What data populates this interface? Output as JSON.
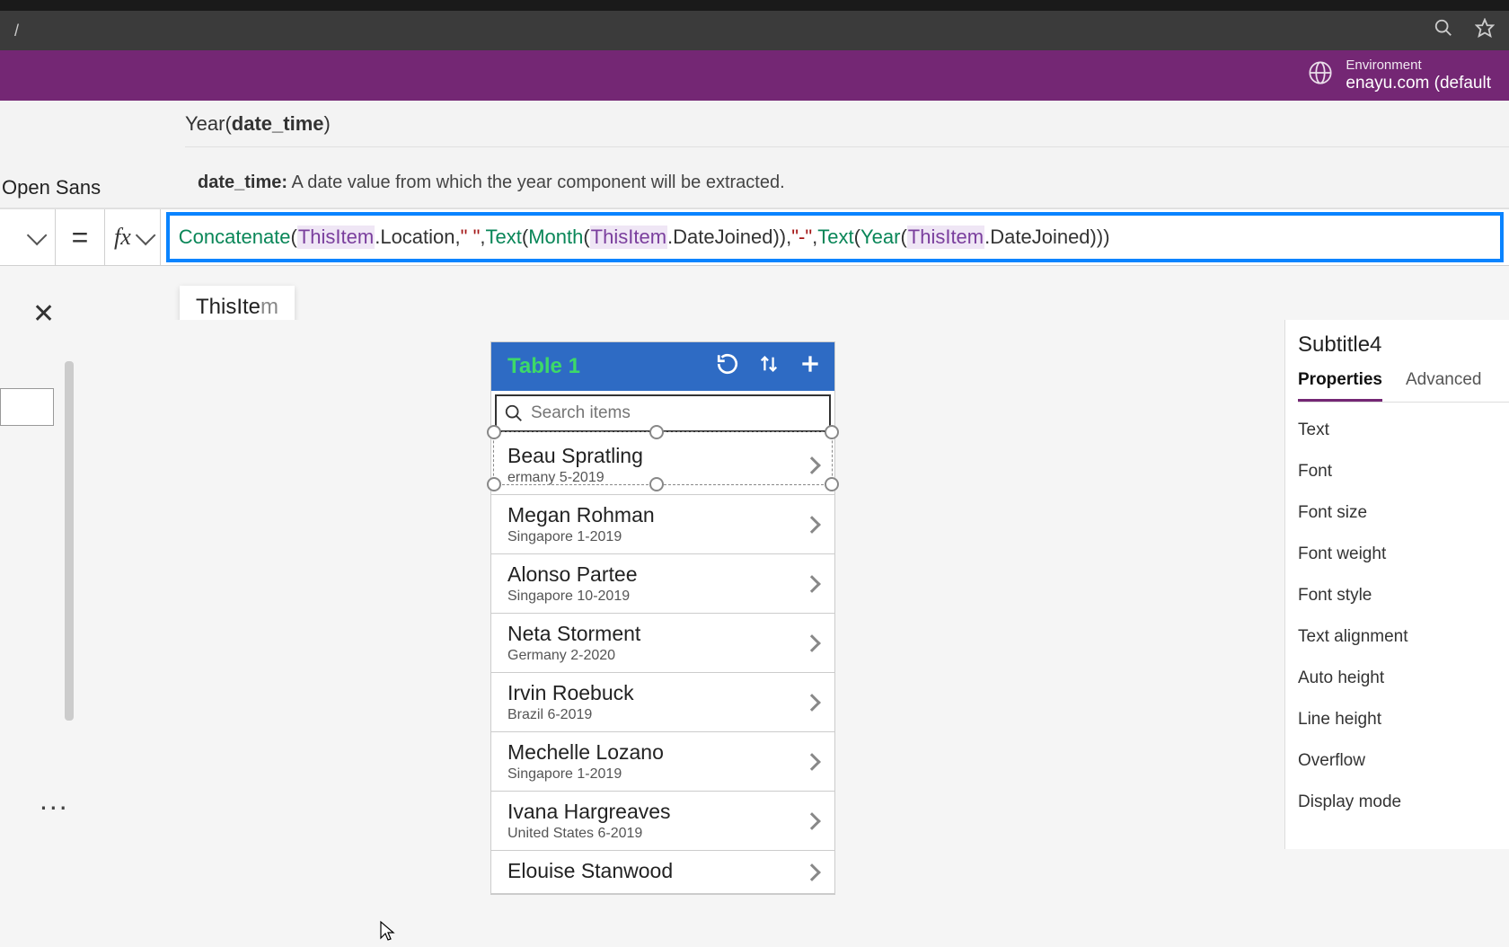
{
  "browser": {
    "url": "/",
    "search_icon": "search",
    "star_icon": "star"
  },
  "header": {
    "env_label": "Environment",
    "env_value": "enayu.com (default"
  },
  "ribbon": {
    "font_name": "Open Sans"
  },
  "help": {
    "signature_fn": "Year(",
    "signature_param": "date_time",
    "signature_close": ")",
    "param_name": "date_time:",
    "param_desc": "A date value from which the year component will be extracted."
  },
  "formula": {
    "tokens": [
      {
        "t": "fn",
        "v": "Concatenate"
      },
      {
        "t": "pun",
        "v": "("
      },
      {
        "t": "this",
        "v": "ThisItem"
      },
      {
        "t": "prop",
        "v": ".Location"
      },
      {
        "t": "pun",
        "v": ", "
      },
      {
        "t": "str",
        "v": "\" \""
      },
      {
        "t": "pun",
        "v": ", "
      },
      {
        "t": "fn",
        "v": "Text"
      },
      {
        "t": "pun",
        "v": "("
      },
      {
        "t": "fn",
        "v": "Month"
      },
      {
        "t": "pun",
        "v": "("
      },
      {
        "t": "this",
        "v": "ThisItem"
      },
      {
        "t": "prop",
        "v": ".DateJoined"
      },
      {
        "t": "pun",
        "v": ")), "
      },
      {
        "t": "str",
        "v": "\"-\""
      },
      {
        "t": "pun",
        "v": ", "
      },
      {
        "t": "fn",
        "v": "Text"
      },
      {
        "t": "pun",
        "v": "("
      },
      {
        "t": "fn",
        "v": "Year"
      },
      {
        "t": "pun",
        "v": "("
      },
      {
        "t": "this",
        "v": "ThisItem"
      },
      {
        "t": "prop",
        "v": ".DateJoined"
      },
      {
        "t": "pun",
        "v": ")))"
      }
    ]
  },
  "intellisense": {
    "bold": "ThisIte",
    "dim": "m"
  },
  "phone": {
    "title": "Table 1",
    "search_placeholder": "Search items",
    "items": [
      {
        "name": "Beau Spratling",
        "sub": "ermany 5-2019"
      },
      {
        "name": "Megan Rohman",
        "sub": "Singapore 1-2019"
      },
      {
        "name": "Alonso Partee",
        "sub": "Singapore 10-2019"
      },
      {
        "name": "Neta Storment",
        "sub": "Germany 2-2020"
      },
      {
        "name": "Irvin Roebuck",
        "sub": "Brazil 6-2019"
      },
      {
        "name": "Mechelle Lozano",
        "sub": "Singapore 1-2019"
      },
      {
        "name": "Ivana Hargreaves",
        "sub": "United States 6-2019"
      },
      {
        "name": "Elouise Stanwood",
        "sub": ""
      }
    ]
  },
  "props": {
    "title": "Subtitle4",
    "tabs": {
      "properties": "Properties",
      "advanced": "Advanced"
    },
    "rows": [
      "Text",
      "Font",
      "Font size",
      "Font weight",
      "Font style",
      "Text alignment",
      "Auto height",
      "Line height",
      "Overflow",
      "Display mode"
    ]
  },
  "misc": {
    "dots": "..."
  }
}
